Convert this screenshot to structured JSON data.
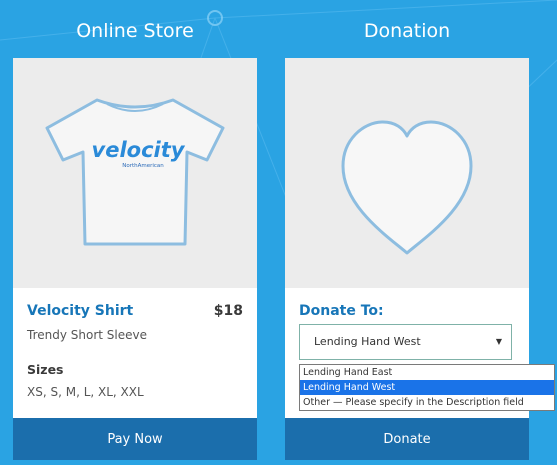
{
  "store": {
    "section_title": "Online Store",
    "shirt_brand": "velocity",
    "shirt_brand_sub": "NorthAmerican",
    "product_name": "Velocity Shirt",
    "price": "$18",
    "subtitle": "Trendy Short Sleeve",
    "sizes_label": "Sizes",
    "sizes_value": "XS, S, M, L, XL, XXL",
    "button_label": "Pay Now"
  },
  "donation": {
    "section_title": "Donation",
    "donate_to_label": "Donate To:",
    "selected_value": "Lending Hand West",
    "options": [
      "Lending Hand East",
      "Lending Hand West",
      "Other — Please specify in the Description field"
    ],
    "selected_index": 1,
    "button_label": "Donate"
  },
  "colors": {
    "background": "#2aa3e3",
    "button": "#1b6eac",
    "accent_text": "#1776b8",
    "option_highlight": "#1a73e8"
  },
  "icons": {
    "product_image": "tshirt-icon",
    "donation_image": "heart-icon",
    "dropdown_caret": "caret-down-icon"
  }
}
